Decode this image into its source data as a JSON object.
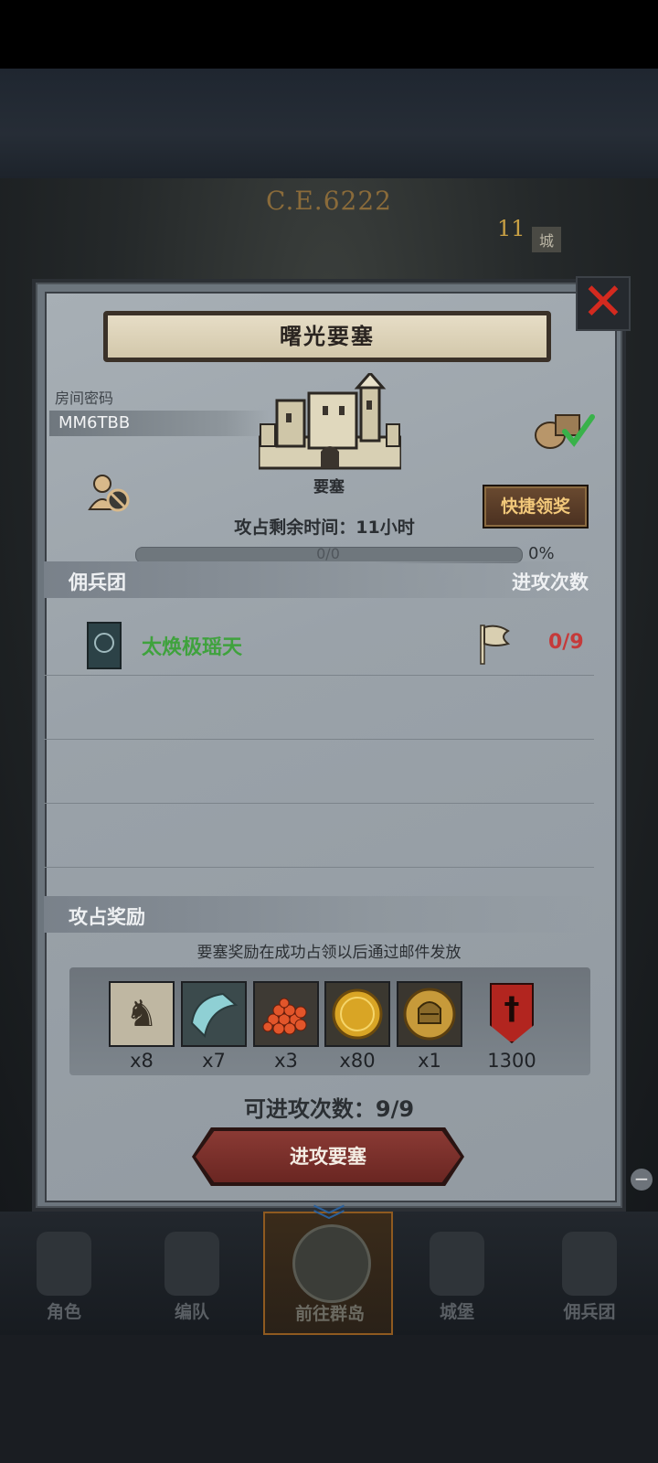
{
  "map": {
    "year_label": "C.E.6222",
    "city_chip": "城",
    "number": "11"
  },
  "dialog": {
    "title": "曙光要塞",
    "close_icon": "close-icon",
    "room": {
      "label": "房间密码",
      "code": "MM6TBB"
    },
    "fortress": {
      "name": "要塞",
      "remaining_time": "攻占剩余时间：11小时",
      "progress_text": "0/0",
      "progress_percent_label": "0%",
      "progress_fraction": 0
    },
    "quick_claim_label": "快捷领奖",
    "mercenary_section": {
      "left_header": "佣兵团",
      "right_header": "进攻次数",
      "rows": [
        {
          "name": "太焕极瑶天",
          "attacks": "0/9"
        }
      ]
    },
    "reward_section": {
      "header": "攻占奖励",
      "note": "要塞奖励在成功占领以后通过邮件发放",
      "items": [
        {
          "icon": "horse-icon",
          "qty": "x8"
        },
        {
          "icon": "cloth-icon",
          "qty": "x7"
        },
        {
          "icon": "caviar-icon",
          "qty": "x3"
        },
        {
          "icon": "gold-coin-icon",
          "qty": "x80"
        },
        {
          "icon": "knight-medal-icon",
          "qty": "x1"
        },
        {
          "icon": "crest-icon",
          "qty": "1300"
        }
      ]
    },
    "attacks_available": "可进攻次数：9/9",
    "attack_button_label": "进攻要塞"
  },
  "bottom_nav": {
    "items": [
      {
        "label": "角色",
        "active": false
      },
      {
        "label": "编队",
        "active": false
      },
      {
        "label": "前往群岛",
        "active": true
      },
      {
        "label": "城堡",
        "active": false
      },
      {
        "label": "佣兵团",
        "active": false
      }
    ]
  },
  "colors": {
    "accent_gold": "#c59a47",
    "merc_green": "#3fa23d",
    "count_red": "#c53a3a",
    "attack_button": "#7a302b"
  }
}
